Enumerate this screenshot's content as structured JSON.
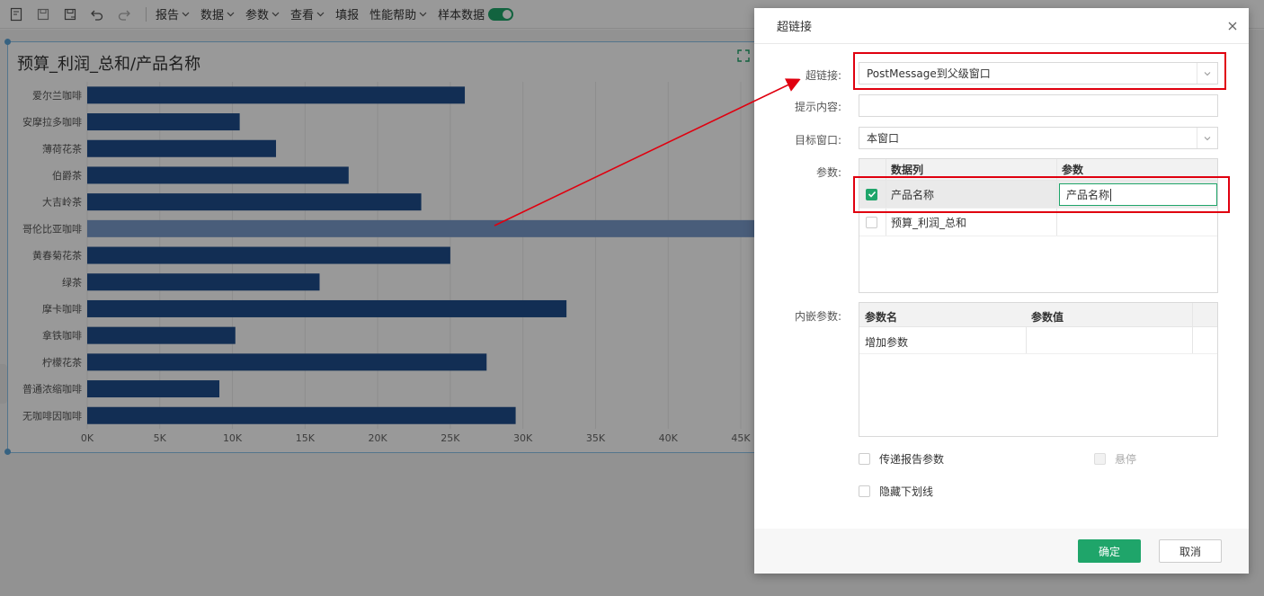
{
  "toolbar": {
    "menus": [
      "报告",
      "数据",
      "参数",
      "查看",
      "填报",
      "性能帮助",
      "样本数据"
    ]
  },
  "chart_data": {
    "type": "bar",
    "title": "预算_利润_总和/产品名称",
    "categories": [
      "爱尔兰咖啡",
      "安摩拉多咖啡",
      "薄荷花茶",
      "伯爵茶",
      "大吉岭茶",
      "哥伦比亚咖啡",
      "黄春菊花茶",
      "绿茶",
      "摩卡咖啡",
      "拿铁咖啡",
      "柠檬花茶",
      "普通浓缩咖啡",
      "无咖啡因咖啡"
    ],
    "values": [
      26000,
      10500,
      13000,
      18000,
      23000,
      46000,
      25000,
      16000,
      33000,
      10200,
      27500,
      9100,
      29500
    ],
    "xticks": [
      "0K",
      "5K",
      "10K",
      "15K",
      "20K",
      "25K",
      "30K",
      "35K",
      "40K",
      "45K"
    ],
    "xlim": [
      0,
      45000
    ],
    "highlight_index": 5,
    "bar_color": "#1f4e8c",
    "grid": true
  },
  "dialog": {
    "title": "超链接",
    "hyperlink_label": "超链接:",
    "hyperlink_value": "PostMessage到父级窗口",
    "tooltip_label": "提示内容:",
    "tooltip_value": "",
    "target_label": "目标窗口:",
    "target_value": "本窗口",
    "params_label": "参数:",
    "params_table": {
      "col1": "数据列",
      "col2": "参数",
      "rows": [
        {
          "column": "产品名称",
          "param": "产品名称",
          "checked": true
        },
        {
          "column": "预算_利润_总和",
          "param": "",
          "checked": false
        }
      ]
    },
    "embed_label": "内嵌参数:",
    "embed_table": {
      "col1": "参数名",
      "col2": "参数值",
      "add_row": "增加参数"
    },
    "pass_report_params": "传递报告参数",
    "hover": "悬停",
    "hide_underline": "隐藏下划线",
    "ok": "确定",
    "cancel": "取消"
  },
  "colors": {
    "accent": "#1fa56a",
    "annotation": "#e0000f"
  }
}
